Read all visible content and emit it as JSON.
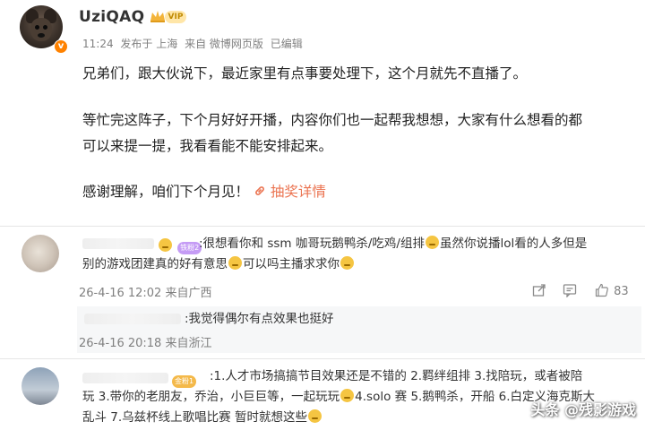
{
  "post": {
    "username": "UziQAQ",
    "vip_label": "VIP",
    "verified_badge": "v",
    "meta": {
      "time": "11:24",
      "published_label": "发布于 上海",
      "source": "来自 微博网页版",
      "edited": "已编辑"
    },
    "body": {
      "line1": "兄弟们，跟大伙说下，最近家里有点事要处理下，这个月就先不直播了。",
      "line2": "等忙完这阵子，下个月好好开播，内容你们也一起帮我想想，大家有什么想看的都",
      "line3": "可以来提一提，我看看能不能安排起来。",
      "line4": "感谢理解，咱们下个月见！",
      "link_label": "抽奖详情"
    },
    "icons": {
      "link": "link-icon",
      "crown": "crown-icon"
    }
  },
  "comments": [
    {
      "fan_badge": "铁粉2",
      "text_line1": ":很想看你和 ssm 咖哥玩鹅鸭杀/吃鸡/组排",
      "text_line1b": "虽然你说播lol看的人多但是",
      "text_line2a": "别的游戏团建真的好有意思",
      "text_line2b": "可以吗主播求求你",
      "time": "26-4-16 12:02",
      "location": "来自广西",
      "likes": "83",
      "colors": {
        "badge": "#c59cf5"
      }
    },
    {
      "fan_badge": "金粉1",
      "text_line1": ":1.人才市场搞搞节目效果还是不错的 2.羁绊组排 3.找陪玩，或者被陪",
      "text_line2a": "玩 3.带你的老朋友，乔治，小巨巨等，一起玩玩",
      "text_line2b": "4.solo 赛 5.鹅鸭杀，开船 6.白定义海克斯大",
      "text_line3a": "乱斗 7.乌兹杯线上歌唱比赛 暂时就想这些",
      "colors": {
        "badge": "#f4b94a"
      }
    }
  ],
  "reply": {
    "text": ":我觉得偶尔有点效果也挺好",
    "time": "26-4-16 20:18",
    "location": "来自浙江"
  },
  "actions": {
    "share_icon": "share-icon",
    "comment_icon": "comment-icon",
    "like_icon": "thumbs-up-icon"
  },
  "watermark": "头条 @残影游戏",
  "colors": {
    "link": "#eb7350",
    "meta_gray": "#808080",
    "verified": "#ff8200"
  }
}
